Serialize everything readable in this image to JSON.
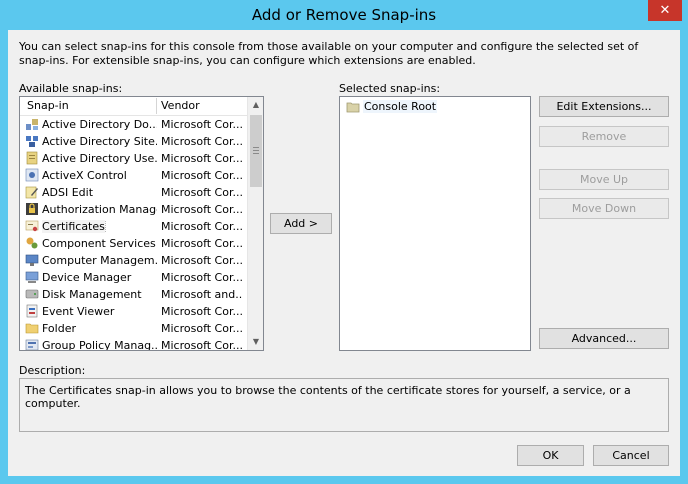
{
  "window": {
    "title": "Add or Remove Snap-ins",
    "close_glyph": "✕"
  },
  "intro_text": "You can select snap-ins for this console from those available on your computer and configure the selected set of snap-ins. For extensible snap-ins, you can configure which extensions are enabled.",
  "available": {
    "label": "Available snap-ins:",
    "columns": {
      "name": "Snap-in",
      "vendor": "Vendor"
    },
    "items": [
      {
        "name": "Active Directory Do...",
        "vendor": "Microsoft Cor...",
        "icon": "ad-domains-icon"
      },
      {
        "name": "Active Directory Site...",
        "vendor": "Microsoft Cor...",
        "icon": "ad-sites-icon"
      },
      {
        "name": "Active Directory Use...",
        "vendor": "Microsoft Cor...",
        "icon": "ad-users-icon"
      },
      {
        "name": "ActiveX Control",
        "vendor": "Microsoft Cor...",
        "icon": "activex-icon"
      },
      {
        "name": "ADSI Edit",
        "vendor": "Microsoft Cor...",
        "icon": "adsi-edit-icon"
      },
      {
        "name": "Authorization Manager",
        "vendor": "Microsoft Cor...",
        "icon": "authorization-icon"
      },
      {
        "name": "Certificates",
        "vendor": "Microsoft Cor...",
        "icon": "certificates-icon",
        "selected": true
      },
      {
        "name": "Component Services",
        "vendor": "Microsoft Cor...",
        "icon": "component-services-icon"
      },
      {
        "name": "Computer Managem...",
        "vendor": "Microsoft Cor...",
        "icon": "computer-management-icon"
      },
      {
        "name": "Device Manager",
        "vendor": "Microsoft Cor...",
        "icon": "device-manager-icon"
      },
      {
        "name": "Disk Management",
        "vendor": "Microsoft and...",
        "icon": "disk-management-icon"
      },
      {
        "name": "Event Viewer",
        "vendor": "Microsoft Cor...",
        "icon": "event-viewer-icon"
      },
      {
        "name": "Folder",
        "vendor": "Microsoft Cor...",
        "icon": "folder-icon"
      },
      {
        "name": "Group Policy Manag...",
        "vendor": "Microsoft Cor...",
        "icon": "group-policy-icon"
      }
    ]
  },
  "add_button": "Add >",
  "selected": {
    "label": "Selected snap-ins:",
    "items": [
      {
        "name": "Console Root",
        "icon": "folder-icon"
      }
    ]
  },
  "buttons": {
    "edit_extensions": "Edit Extensions...",
    "remove": "Remove",
    "move_up": "Move Up",
    "move_down": "Move Down",
    "advanced": "Advanced..."
  },
  "description": {
    "label": "Description:",
    "text": "The Certificates snap-in allows you to browse the contents of the certificate stores for yourself, a service, or a computer."
  },
  "footer": {
    "ok": "OK",
    "cancel": "Cancel"
  },
  "colors": {
    "title_bar": "#5bc8ee",
    "close_button": "#c7352a",
    "dialog_bg": "#f0f0f0"
  }
}
